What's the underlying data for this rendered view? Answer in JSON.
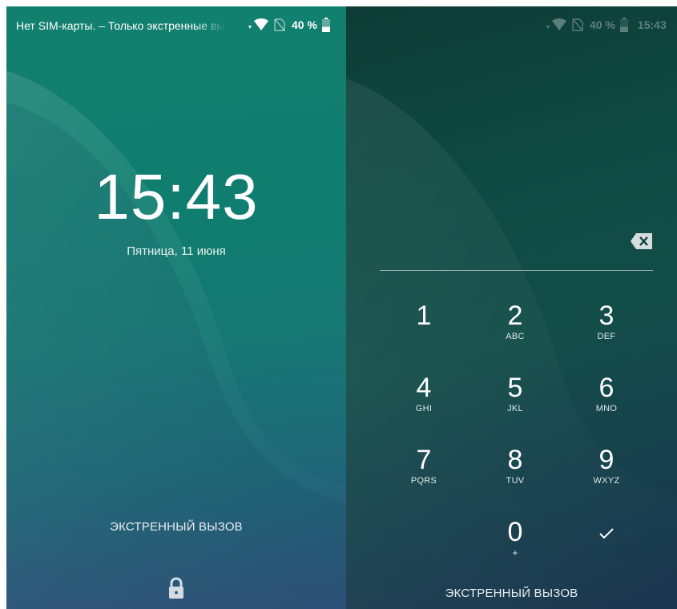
{
  "lock_screen": {
    "status": {
      "carrier": "Нет SIM-карты. – Только экстренные вызовы",
      "battery_percent": "40 %",
      "battery_level": 0.4
    },
    "time": "15:43",
    "date": "Пятница, 11 июня",
    "emergency_label": "ЭКСТРЕННЫЙ ВЫЗОВ",
    "lock_icon": "lock-icon"
  },
  "pin_screen": {
    "status": {
      "battery_percent": "40 %",
      "time": "15:43",
      "battery_level": 0.4
    },
    "keys": [
      {
        "digit": "1",
        "letters": ""
      },
      {
        "digit": "2",
        "letters": "ABC"
      },
      {
        "digit": "3",
        "letters": "DEF"
      },
      {
        "digit": "4",
        "letters": "GHI"
      },
      {
        "digit": "5",
        "letters": "JKL"
      },
      {
        "digit": "6",
        "letters": "MNO"
      },
      {
        "digit": "7",
        "letters": "PQRS"
      },
      {
        "digit": "8",
        "letters": "TUV"
      },
      {
        "digit": "9",
        "letters": "WXYZ"
      },
      {
        "digit": "0",
        "letters": "+"
      }
    ],
    "backspace_icon": "backspace-icon",
    "enter_icon": "check-icon",
    "emergency_label": "ЭКСТРЕННЫЙ ВЫЗОВ"
  },
  "colors": {
    "lock_bg_top": "#13806e",
    "lock_bg_bottom": "#354f7a",
    "pin_bg_top": "#0e3c35",
    "pin_bg_bottom": "#1c3650",
    "text": "#ffffff"
  }
}
